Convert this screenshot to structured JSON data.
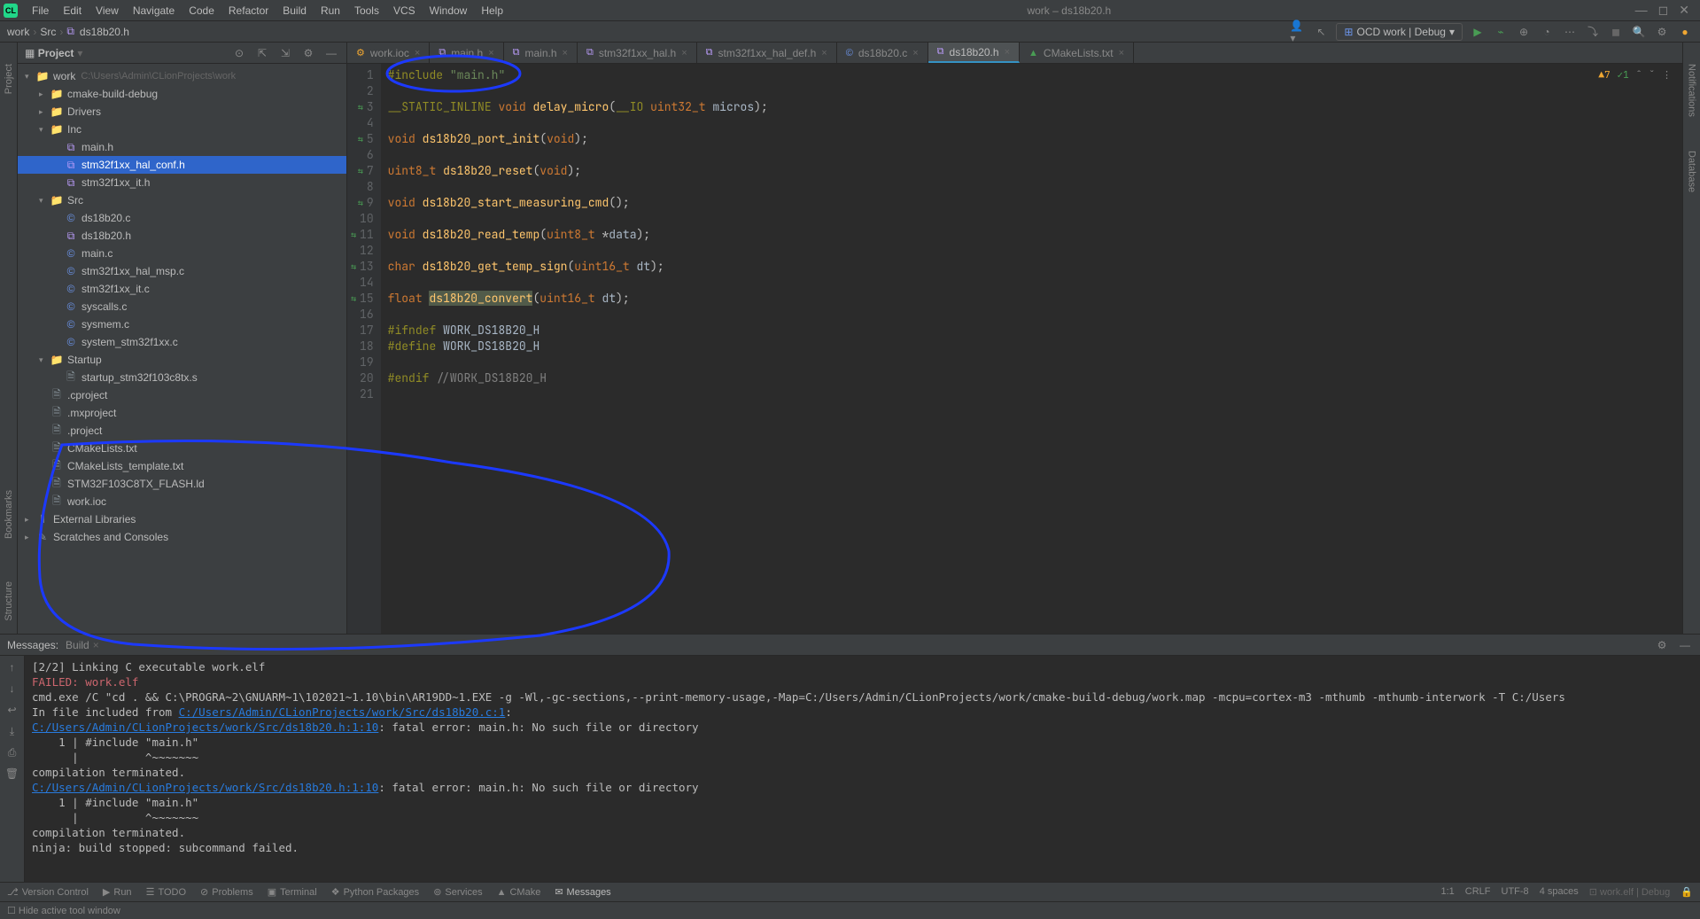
{
  "window": {
    "title": "work – ds18b20.h",
    "logo": "CL"
  },
  "menu": [
    "File",
    "Edit",
    "View",
    "Navigate",
    "Code",
    "Refactor",
    "Build",
    "Run",
    "Tools",
    "VCS",
    "Window",
    "Help"
  ],
  "breadcrumb": [
    "work",
    "Src",
    "ds18b20.h"
  ],
  "run_config": "OCD work | Debug",
  "sidebar": {
    "title": "Project",
    "tree": [
      {
        "depth": 0,
        "arrow": "▾",
        "icon": "folder",
        "name": "work",
        "path": "C:\\Users\\Admin\\CLionProjects\\work"
      },
      {
        "depth": 1,
        "arrow": "▸",
        "icon": "folder-orange",
        "name": "cmake-build-debug"
      },
      {
        "depth": 1,
        "arrow": "▸",
        "icon": "folder",
        "name": "Drivers"
      },
      {
        "depth": 1,
        "arrow": "▾",
        "icon": "folder",
        "name": "Inc"
      },
      {
        "depth": 2,
        "icon": "h",
        "name": "main.h"
      },
      {
        "depth": 2,
        "icon": "h",
        "name": "stm32f1xx_hal_conf.h",
        "selected": true
      },
      {
        "depth": 2,
        "icon": "h",
        "name": "stm32f1xx_it.h"
      },
      {
        "depth": 1,
        "arrow": "▾",
        "icon": "folder",
        "name": "Src"
      },
      {
        "depth": 2,
        "icon": "c",
        "name": "ds18b20.c"
      },
      {
        "depth": 2,
        "icon": "h",
        "name": "ds18b20.h"
      },
      {
        "depth": 2,
        "icon": "c",
        "name": "main.c"
      },
      {
        "depth": 2,
        "icon": "c",
        "name": "stm32f1xx_hal_msp.c"
      },
      {
        "depth": 2,
        "icon": "c",
        "name": "stm32f1xx_it.c"
      },
      {
        "depth": 2,
        "icon": "c",
        "name": "syscalls.c"
      },
      {
        "depth": 2,
        "icon": "c",
        "name": "sysmem.c"
      },
      {
        "depth": 2,
        "icon": "c",
        "name": "system_stm32f1xx.c"
      },
      {
        "depth": 1,
        "arrow": "▾",
        "icon": "folder",
        "name": "Startup"
      },
      {
        "depth": 2,
        "icon": "file",
        "name": "startup_stm32f103c8tx.s"
      },
      {
        "depth": 1,
        "icon": "file",
        "name": ".cproject"
      },
      {
        "depth": 1,
        "icon": "file",
        "name": ".mxproject"
      },
      {
        "depth": 1,
        "icon": "file",
        "name": ".project"
      },
      {
        "depth": 1,
        "icon": "file",
        "name": "CMakeLists.txt"
      },
      {
        "depth": 1,
        "icon": "file",
        "name": "CMakeLists_template.txt"
      },
      {
        "depth": 1,
        "icon": "file",
        "name": "STM32F103C8TX_FLASH.ld"
      },
      {
        "depth": 1,
        "icon": "file",
        "name": "work.ioc"
      },
      {
        "depth": 0,
        "arrow": "▸",
        "icon": "lib",
        "name": "External Libraries"
      },
      {
        "depth": 0,
        "arrow": "▸",
        "icon": "scratch",
        "name": "Scratches and Consoles"
      }
    ]
  },
  "tabs": [
    {
      "icon": "ioc",
      "name": "work.ioc"
    },
    {
      "icon": "h",
      "name": "main.h"
    },
    {
      "icon": "h",
      "name": "main.h"
    },
    {
      "icon": "h",
      "name": "stm32f1xx_hal.h"
    },
    {
      "icon": "h",
      "name": "stm32f1xx_hal_def.h"
    },
    {
      "icon": "c",
      "name": "ds18b20.c"
    },
    {
      "icon": "h",
      "name": "ds18b20.h",
      "active": true
    },
    {
      "icon": "cmake",
      "name": "CMakeLists.txt"
    }
  ],
  "editor_status": {
    "warnings": "7",
    "ok": "1"
  },
  "code_lines": [
    {
      "n": 1,
      "html": "<span class='macro'>#include</span> <span class='str'>\"main.h\"</span>",
      "caret": true
    },
    {
      "n": 2,
      "html": ""
    },
    {
      "n": 3,
      "ind": "⇆",
      "html": "<span class='macro'>__STATIC_INLINE</span> <span class='kw'>void</span> <span class='fn'>delay_micro</span>(<span class='macro'>__IO</span> <span class='type'>uint32_t</span> <span class='param'>micros</span>);"
    },
    {
      "n": 4,
      "html": ""
    },
    {
      "n": 5,
      "ind": "⇆",
      "html": "<span class='kw'>void</span> <span class='fn'>ds18b20_port_init</span>(<span class='kw'>void</span>);"
    },
    {
      "n": 6,
      "html": ""
    },
    {
      "n": 7,
      "ind": "⇆",
      "html": "<span class='type'>uint8_t</span> <span class='fn'>ds18b20_reset</span>(<span class='kw'>void</span>);"
    },
    {
      "n": 8,
      "html": ""
    },
    {
      "n": 9,
      "ind": "⇆",
      "html": "<span class='kw'>void</span> <span class='fn'>ds18b20_start_measuring_cmd</span>();"
    },
    {
      "n": 10,
      "html": ""
    },
    {
      "n": 11,
      "ind": "⇆",
      "html": "<span class='kw'>void</span> <span class='fn'>ds18b20_read_temp</span>(<span class='type'>uint8_t</span> *<span class='param'>data</span>);"
    },
    {
      "n": 12,
      "html": ""
    },
    {
      "n": 13,
      "ind": "⇆",
      "html": "<span class='kw'>char</span> <span class='fn'>ds18b20_get_temp_sign</span>(<span class='type'>uint16_t</span> <span class='param'>dt</span>);"
    },
    {
      "n": 14,
      "html": ""
    },
    {
      "n": 15,
      "ind": "⇆",
      "html": "<span class='kw'>float</span> <span class='fn hl'>ds18b20_convert</span>(<span class='type'>uint16_t</span> <span class='param'>dt</span>);"
    },
    {
      "n": 16,
      "html": ""
    },
    {
      "n": 17,
      "html": "<span class='macro'>#ifndef</span> <span class='ident'>WORK_DS18B20_H</span>"
    },
    {
      "n": 18,
      "html": "<span class='macro'>#define</span> <span class='ident'>WORK_DS18B20_H</span>"
    },
    {
      "n": 19,
      "html": ""
    },
    {
      "n": 20,
      "html": "<span class='macro'>#endif</span> <span class='comment'>//WORK_DS18B20_H</span>"
    },
    {
      "n": 21,
      "html": ""
    }
  ],
  "messages": {
    "header": "Messages:",
    "tab": "Build",
    "lines": [
      "[2/2] Linking C executable work.elf",
      "<span class='err'>FAILED: work.elf</span>",
      "cmd.exe /C \"cd . && C:\\PROGRA~2\\GNUARM~1\\102021~1.10\\bin\\AR19DD~1.EXE -g -Wl,-gc-sections,--print-memory-usage,-Map=C:/Users/Admin/CLionProjects/work/cmake-build-debug/work.map -mcpu=cortex-m3 -mthumb -mthumb-interwork -T C:/Users",
      "In file included from <span class='link'>C:/Users/Admin/CLionProjects/work/Src/ds18b20.c:1</span>:",
      "<span class='link'>C:/Users/Admin/CLionProjects/work/Src/ds18b20.h:1:10</span>: fatal error: main.h: No such file or directory",
      "    1 | #include \"main.h\"",
      "      |          ^~~~~~~~",
      "compilation terminated.",
      "<span class='link'>C:/Users/Admin/CLionProjects/work/Src/ds18b20.h:1:10</span>: fatal error: main.h: No such file or directory",
      "    1 | #include \"main.h\"",
      "      |          ^~~~~~~~",
      "compilation terminated.",
      "ninja: build stopped: subcommand failed.",
      ""
    ]
  },
  "bottom_tools": [
    {
      "icon": "⎇",
      "name": "Version Control"
    },
    {
      "icon": "▶",
      "name": "Run"
    },
    {
      "icon": "☰",
      "name": "TODO"
    },
    {
      "icon": "⊘",
      "name": "Problems"
    },
    {
      "icon": "▣",
      "name": "Terminal"
    },
    {
      "icon": "❖",
      "name": "Python Packages"
    },
    {
      "icon": "⊚",
      "name": "Services"
    },
    {
      "icon": "▲",
      "name": "CMake"
    },
    {
      "icon": "✉",
      "name": "Messages",
      "active": true
    }
  ],
  "status": {
    "left": "Hide active tool window",
    "pos": "1:1",
    "sep": "CRLF",
    "enc": "UTF-8",
    "indent": "4 spaces",
    "context": "work.elf | Debug"
  }
}
